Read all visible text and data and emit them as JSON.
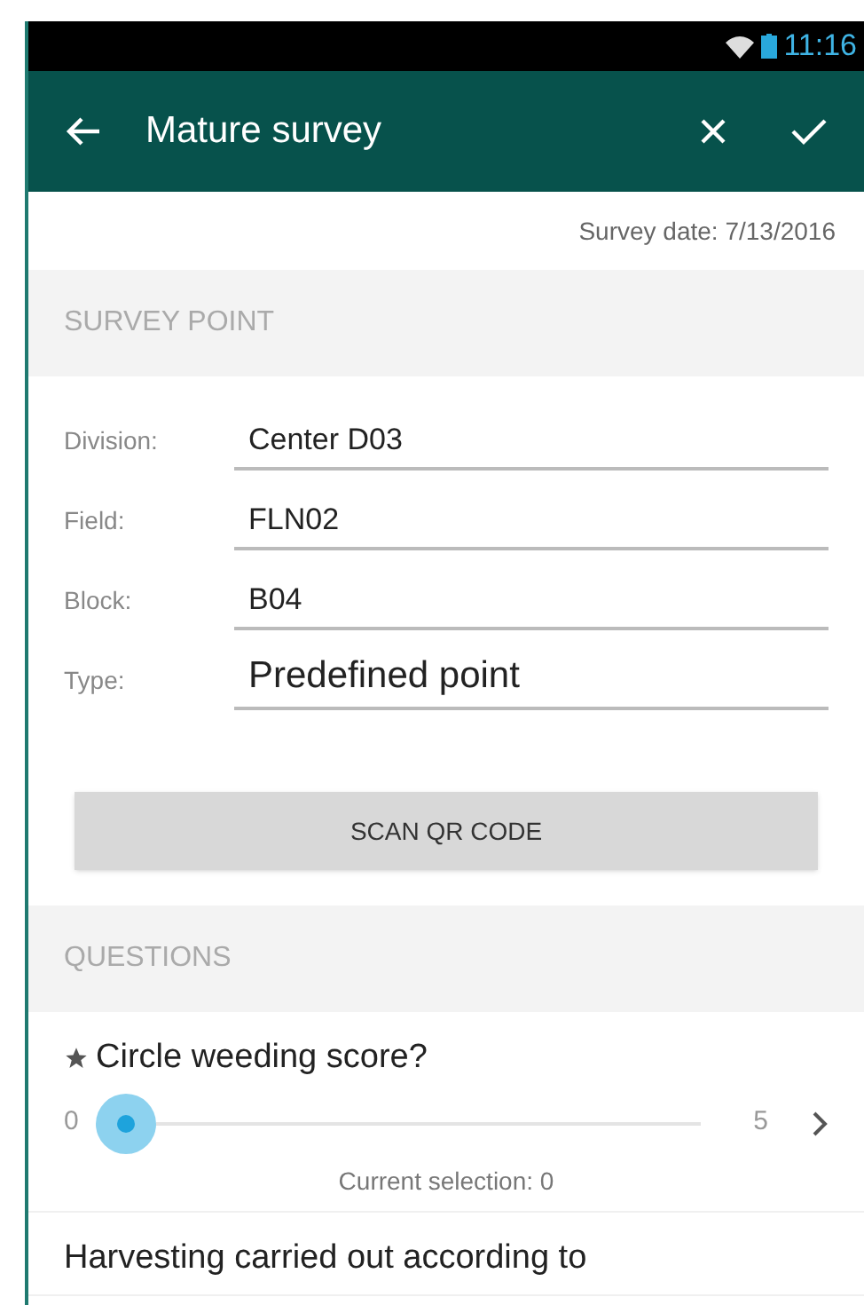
{
  "status_bar": {
    "time": "11:16"
  },
  "app_bar": {
    "title": "Mature survey"
  },
  "survey_date": "Survey date: 7/13/2016",
  "survey_point": {
    "header": "SURVEY POINT",
    "fields": [
      {
        "label": "Division:",
        "value": "Center D03",
        "large": false
      },
      {
        "label": "Field:",
        "value": "FLN02",
        "large": false
      },
      {
        "label": "Block:",
        "value": "B04",
        "large": false
      },
      {
        "label": "Type:",
        "value": "Predefined point",
        "large": true
      }
    ],
    "button": "SCAN QR CODE"
  },
  "questions": {
    "header": "QUESTIONS",
    "items": [
      {
        "kind": "slider",
        "required": true,
        "text": "Circle weeding score?",
        "min": "0",
        "max": "5",
        "selection": "Current selection: 0"
      },
      {
        "kind": "text",
        "required": false,
        "text": "Harvesting carried out according to"
      }
    ]
  }
}
